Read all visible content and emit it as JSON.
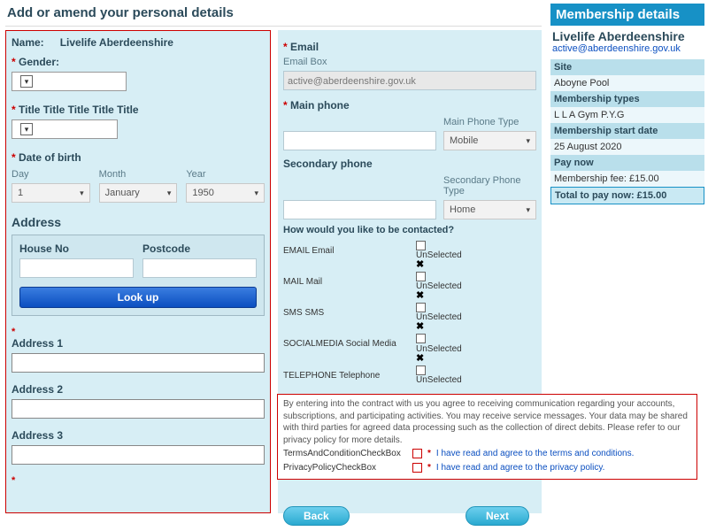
{
  "page_title": "Add or amend your personal details",
  "name": {
    "label": "Name:",
    "value": "Livelife Aberdeenshire"
  },
  "gender": {
    "label": "Gender:",
    "value": ""
  },
  "title": {
    "label": "Title Title Title Title Title",
    "value": ""
  },
  "dob": {
    "label": "Date of birth",
    "day": {
      "label": "Day",
      "value": "1"
    },
    "month": {
      "label": "Month",
      "value": "January"
    },
    "year": {
      "label": "Year",
      "value": "1950"
    }
  },
  "address": {
    "heading": "Address",
    "house_no": {
      "label": "House No",
      "value": ""
    },
    "postcode": {
      "label": "Postcode",
      "value": ""
    },
    "lookup_btn": "Look up",
    "addr1": {
      "label": "Address 1",
      "value": ""
    },
    "addr2": {
      "label": "Address 2",
      "value": ""
    },
    "addr3": {
      "label": "Address 3",
      "value": ""
    }
  },
  "email": {
    "label": "Email",
    "box_label": "Email Box",
    "value": "active@aberdeenshire.gov.uk"
  },
  "main_phone": {
    "label": "Main phone",
    "value": "",
    "type_label": "Main Phone Type",
    "type_value": "Mobile"
  },
  "secondary_phone": {
    "label": "Secondary phone",
    "value": "",
    "type_label": "Secondary Phone Type",
    "type_value": "Home"
  },
  "contact": {
    "question": "How would you like to be contacted?",
    "status": "UnSelected",
    "items": {
      "email": "EMAIL Email",
      "mail": "MAIL Mail",
      "sms": "SMS SMS",
      "social": "SOCIALMEDIA Social Media",
      "tel": "TELEPHONE Telephone"
    }
  },
  "policy": {
    "text": "By entering into the contract with us you agree to receiving communication regarding your accounts, subscriptions, and participating activities. You may receive service messages. Your data may be shared with third parties for agreed data processing such as the collection of direct debits. Please refer to our privacy policy for more details.",
    "terms_label": "TermsAndConditionCheckBox",
    "terms_link": "I have read and agree to the terms and conditions.",
    "privacy_label": "PrivacyPolicyCheckBox",
    "privacy_link": "I have read and agree to the privacy policy."
  },
  "buttons": {
    "back": "Back",
    "next": "Next"
  },
  "membership": {
    "header": "Membership details",
    "name": "Livelife Aberdeenshire",
    "email": "active@aberdeenshire.gov.uk",
    "site_label": "Site",
    "site_value": "Aboyne Pool",
    "types_label": "Membership types",
    "types_value": "L L A Gym P.Y.G",
    "start_label": "Membership start date",
    "start_value": "25 August 2020",
    "pay_label": "Pay now",
    "fee_label": "Membership fee: £15.00",
    "total_label": "Total to pay now: £15.00"
  }
}
